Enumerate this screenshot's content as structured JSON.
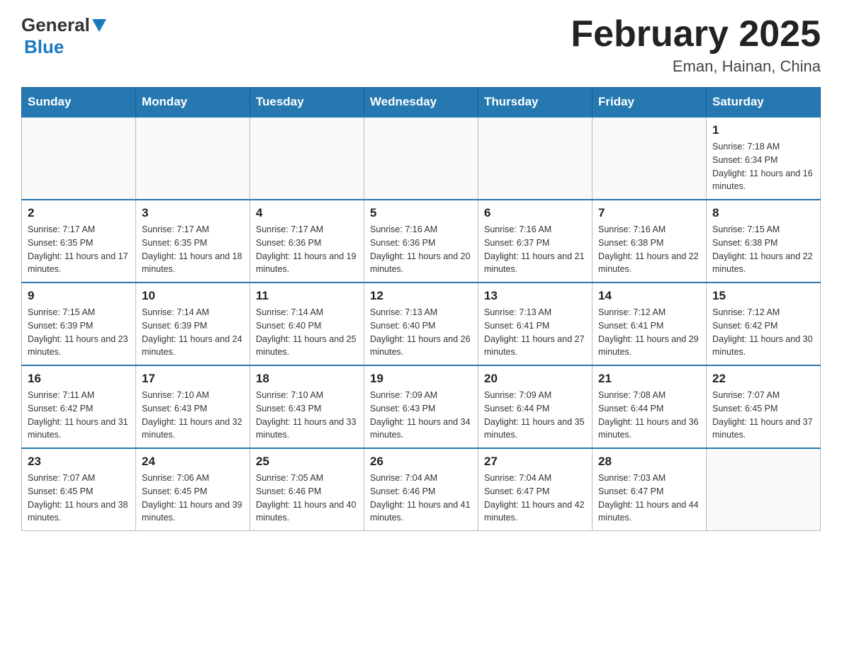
{
  "header": {
    "logo": {
      "general": "General",
      "blue": "Blue"
    },
    "title": "February 2025",
    "location": "Eman, Hainan, China"
  },
  "weekdays": [
    "Sunday",
    "Monday",
    "Tuesday",
    "Wednesday",
    "Thursday",
    "Friday",
    "Saturday"
  ],
  "weeks": [
    [
      {
        "day": "",
        "info": ""
      },
      {
        "day": "",
        "info": ""
      },
      {
        "day": "",
        "info": ""
      },
      {
        "day": "",
        "info": ""
      },
      {
        "day": "",
        "info": ""
      },
      {
        "day": "",
        "info": ""
      },
      {
        "day": "1",
        "info": "Sunrise: 7:18 AM\nSunset: 6:34 PM\nDaylight: 11 hours and 16 minutes."
      }
    ],
    [
      {
        "day": "2",
        "info": "Sunrise: 7:17 AM\nSunset: 6:35 PM\nDaylight: 11 hours and 17 minutes."
      },
      {
        "day": "3",
        "info": "Sunrise: 7:17 AM\nSunset: 6:35 PM\nDaylight: 11 hours and 18 minutes."
      },
      {
        "day": "4",
        "info": "Sunrise: 7:17 AM\nSunset: 6:36 PM\nDaylight: 11 hours and 19 minutes."
      },
      {
        "day": "5",
        "info": "Sunrise: 7:16 AM\nSunset: 6:36 PM\nDaylight: 11 hours and 20 minutes."
      },
      {
        "day": "6",
        "info": "Sunrise: 7:16 AM\nSunset: 6:37 PM\nDaylight: 11 hours and 21 minutes."
      },
      {
        "day": "7",
        "info": "Sunrise: 7:16 AM\nSunset: 6:38 PM\nDaylight: 11 hours and 22 minutes."
      },
      {
        "day": "8",
        "info": "Sunrise: 7:15 AM\nSunset: 6:38 PM\nDaylight: 11 hours and 22 minutes."
      }
    ],
    [
      {
        "day": "9",
        "info": "Sunrise: 7:15 AM\nSunset: 6:39 PM\nDaylight: 11 hours and 23 minutes."
      },
      {
        "day": "10",
        "info": "Sunrise: 7:14 AM\nSunset: 6:39 PM\nDaylight: 11 hours and 24 minutes."
      },
      {
        "day": "11",
        "info": "Sunrise: 7:14 AM\nSunset: 6:40 PM\nDaylight: 11 hours and 25 minutes."
      },
      {
        "day": "12",
        "info": "Sunrise: 7:13 AM\nSunset: 6:40 PM\nDaylight: 11 hours and 26 minutes."
      },
      {
        "day": "13",
        "info": "Sunrise: 7:13 AM\nSunset: 6:41 PM\nDaylight: 11 hours and 27 minutes."
      },
      {
        "day": "14",
        "info": "Sunrise: 7:12 AM\nSunset: 6:41 PM\nDaylight: 11 hours and 29 minutes."
      },
      {
        "day": "15",
        "info": "Sunrise: 7:12 AM\nSunset: 6:42 PM\nDaylight: 11 hours and 30 minutes."
      }
    ],
    [
      {
        "day": "16",
        "info": "Sunrise: 7:11 AM\nSunset: 6:42 PM\nDaylight: 11 hours and 31 minutes."
      },
      {
        "day": "17",
        "info": "Sunrise: 7:10 AM\nSunset: 6:43 PM\nDaylight: 11 hours and 32 minutes."
      },
      {
        "day": "18",
        "info": "Sunrise: 7:10 AM\nSunset: 6:43 PM\nDaylight: 11 hours and 33 minutes."
      },
      {
        "day": "19",
        "info": "Sunrise: 7:09 AM\nSunset: 6:43 PM\nDaylight: 11 hours and 34 minutes."
      },
      {
        "day": "20",
        "info": "Sunrise: 7:09 AM\nSunset: 6:44 PM\nDaylight: 11 hours and 35 minutes."
      },
      {
        "day": "21",
        "info": "Sunrise: 7:08 AM\nSunset: 6:44 PM\nDaylight: 11 hours and 36 minutes."
      },
      {
        "day": "22",
        "info": "Sunrise: 7:07 AM\nSunset: 6:45 PM\nDaylight: 11 hours and 37 minutes."
      }
    ],
    [
      {
        "day": "23",
        "info": "Sunrise: 7:07 AM\nSunset: 6:45 PM\nDaylight: 11 hours and 38 minutes."
      },
      {
        "day": "24",
        "info": "Sunrise: 7:06 AM\nSunset: 6:45 PM\nDaylight: 11 hours and 39 minutes."
      },
      {
        "day": "25",
        "info": "Sunrise: 7:05 AM\nSunset: 6:46 PM\nDaylight: 11 hours and 40 minutes."
      },
      {
        "day": "26",
        "info": "Sunrise: 7:04 AM\nSunset: 6:46 PM\nDaylight: 11 hours and 41 minutes."
      },
      {
        "day": "27",
        "info": "Sunrise: 7:04 AM\nSunset: 6:47 PM\nDaylight: 11 hours and 42 minutes."
      },
      {
        "day": "28",
        "info": "Sunrise: 7:03 AM\nSunset: 6:47 PM\nDaylight: 11 hours and 44 minutes."
      },
      {
        "day": "",
        "info": ""
      }
    ]
  ]
}
